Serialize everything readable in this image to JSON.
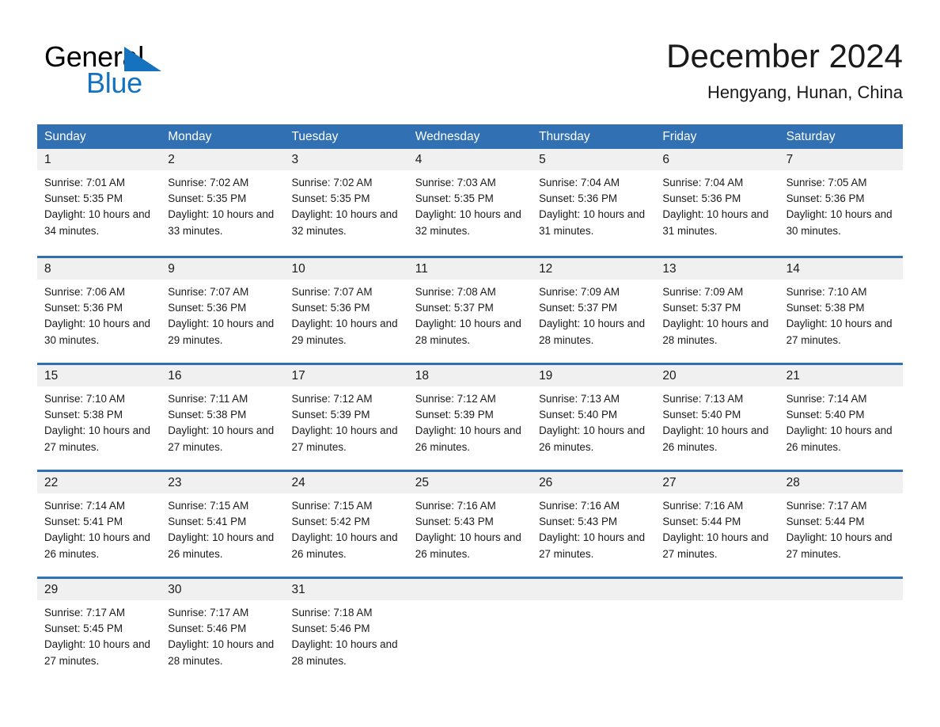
{
  "brand": {
    "logo_line1": "General",
    "logo_line2": "Blue",
    "logo_triangle_icon": "triangle-icon",
    "black": "#000000",
    "blue": "#1572BE"
  },
  "header": {
    "title": "December 2024",
    "subtitle": "Hengyang, Hunan, China"
  },
  "theme": {
    "header_blue": "#3070B3",
    "day_band_gray": "#f0f0f0",
    "text": "#1a1a1a"
  },
  "weekdays": [
    "Sunday",
    "Monday",
    "Tuesday",
    "Wednesday",
    "Thursday",
    "Friday",
    "Saturday"
  ],
  "weeks": [
    {
      "days": [
        {
          "num": "1",
          "sunrise": "Sunrise: 7:01 AM",
          "sunset": "Sunset: 5:35 PM",
          "daylight": "Daylight: 10 hours and 34 minutes."
        },
        {
          "num": "2",
          "sunrise": "Sunrise: 7:02 AM",
          "sunset": "Sunset: 5:35 PM",
          "daylight": "Daylight: 10 hours and 33 minutes."
        },
        {
          "num": "3",
          "sunrise": "Sunrise: 7:02 AM",
          "sunset": "Sunset: 5:35 PM",
          "daylight": "Daylight: 10 hours and 32 minutes."
        },
        {
          "num": "4",
          "sunrise": "Sunrise: 7:03 AM",
          "sunset": "Sunset: 5:35 PM",
          "daylight": "Daylight: 10 hours and 32 minutes."
        },
        {
          "num": "5",
          "sunrise": "Sunrise: 7:04 AM",
          "sunset": "Sunset: 5:36 PM",
          "daylight": "Daylight: 10 hours and 31 minutes."
        },
        {
          "num": "6",
          "sunrise": "Sunrise: 7:04 AM",
          "sunset": "Sunset: 5:36 PM",
          "daylight": "Daylight: 10 hours and 31 minutes."
        },
        {
          "num": "7",
          "sunrise": "Sunrise: 7:05 AM",
          "sunset": "Sunset: 5:36 PM",
          "daylight": "Daylight: 10 hours and 30 minutes."
        }
      ]
    },
    {
      "days": [
        {
          "num": "8",
          "sunrise": "Sunrise: 7:06 AM",
          "sunset": "Sunset: 5:36 PM",
          "daylight": "Daylight: 10 hours and 30 minutes."
        },
        {
          "num": "9",
          "sunrise": "Sunrise: 7:07 AM",
          "sunset": "Sunset: 5:36 PM",
          "daylight": "Daylight: 10 hours and 29 minutes."
        },
        {
          "num": "10",
          "sunrise": "Sunrise: 7:07 AM",
          "sunset": "Sunset: 5:36 PM",
          "daylight": "Daylight: 10 hours and 29 minutes."
        },
        {
          "num": "11",
          "sunrise": "Sunrise: 7:08 AM",
          "sunset": "Sunset: 5:37 PM",
          "daylight": "Daylight: 10 hours and 28 minutes."
        },
        {
          "num": "12",
          "sunrise": "Sunrise: 7:09 AM",
          "sunset": "Sunset: 5:37 PM",
          "daylight": "Daylight: 10 hours and 28 minutes."
        },
        {
          "num": "13",
          "sunrise": "Sunrise: 7:09 AM",
          "sunset": "Sunset: 5:37 PM",
          "daylight": "Daylight: 10 hours and 28 minutes."
        },
        {
          "num": "14",
          "sunrise": "Sunrise: 7:10 AM",
          "sunset": "Sunset: 5:38 PM",
          "daylight": "Daylight: 10 hours and 27 minutes."
        }
      ]
    },
    {
      "days": [
        {
          "num": "15",
          "sunrise": "Sunrise: 7:10 AM",
          "sunset": "Sunset: 5:38 PM",
          "daylight": "Daylight: 10 hours and 27 minutes."
        },
        {
          "num": "16",
          "sunrise": "Sunrise: 7:11 AM",
          "sunset": "Sunset: 5:38 PM",
          "daylight": "Daylight: 10 hours and 27 minutes."
        },
        {
          "num": "17",
          "sunrise": "Sunrise: 7:12 AM",
          "sunset": "Sunset: 5:39 PM",
          "daylight": "Daylight: 10 hours and 27 minutes."
        },
        {
          "num": "18",
          "sunrise": "Sunrise: 7:12 AM",
          "sunset": "Sunset: 5:39 PM",
          "daylight": "Daylight: 10 hours and 26 minutes."
        },
        {
          "num": "19",
          "sunrise": "Sunrise: 7:13 AM",
          "sunset": "Sunset: 5:40 PM",
          "daylight": "Daylight: 10 hours and 26 minutes."
        },
        {
          "num": "20",
          "sunrise": "Sunrise: 7:13 AM",
          "sunset": "Sunset: 5:40 PM",
          "daylight": "Daylight: 10 hours and 26 minutes."
        },
        {
          "num": "21",
          "sunrise": "Sunrise: 7:14 AM",
          "sunset": "Sunset: 5:40 PM",
          "daylight": "Daylight: 10 hours and 26 minutes."
        }
      ]
    },
    {
      "days": [
        {
          "num": "22",
          "sunrise": "Sunrise: 7:14 AM",
          "sunset": "Sunset: 5:41 PM",
          "daylight": "Daylight: 10 hours and 26 minutes."
        },
        {
          "num": "23",
          "sunrise": "Sunrise: 7:15 AM",
          "sunset": "Sunset: 5:41 PM",
          "daylight": "Daylight: 10 hours and 26 minutes."
        },
        {
          "num": "24",
          "sunrise": "Sunrise: 7:15 AM",
          "sunset": "Sunset: 5:42 PM",
          "daylight": "Daylight: 10 hours and 26 minutes."
        },
        {
          "num": "25",
          "sunrise": "Sunrise: 7:16 AM",
          "sunset": "Sunset: 5:43 PM",
          "daylight": "Daylight: 10 hours and 26 minutes."
        },
        {
          "num": "26",
          "sunrise": "Sunrise: 7:16 AM",
          "sunset": "Sunset: 5:43 PM",
          "daylight": "Daylight: 10 hours and 27 minutes."
        },
        {
          "num": "27",
          "sunrise": "Sunrise: 7:16 AM",
          "sunset": "Sunset: 5:44 PM",
          "daylight": "Daylight: 10 hours and 27 minutes."
        },
        {
          "num": "28",
          "sunrise": "Sunrise: 7:17 AM",
          "sunset": "Sunset: 5:44 PM",
          "daylight": "Daylight: 10 hours and 27 minutes."
        }
      ]
    },
    {
      "days": [
        {
          "num": "29",
          "sunrise": "Sunrise: 7:17 AM",
          "sunset": "Sunset: 5:45 PM",
          "daylight": "Daylight: 10 hours and 27 minutes."
        },
        {
          "num": "30",
          "sunrise": "Sunrise: 7:17 AM",
          "sunset": "Sunset: 5:46 PM",
          "daylight": "Daylight: 10 hours and 28 minutes."
        },
        {
          "num": "31",
          "sunrise": "Sunrise: 7:18 AM",
          "sunset": "Sunset: 5:46 PM",
          "daylight": "Daylight: 10 hours and 28 minutes."
        },
        {
          "num": "",
          "sunrise": "",
          "sunset": "",
          "daylight": ""
        },
        {
          "num": "",
          "sunrise": "",
          "sunset": "",
          "daylight": ""
        },
        {
          "num": "",
          "sunrise": "",
          "sunset": "",
          "daylight": ""
        },
        {
          "num": "",
          "sunrise": "",
          "sunset": "",
          "daylight": ""
        }
      ]
    }
  ]
}
